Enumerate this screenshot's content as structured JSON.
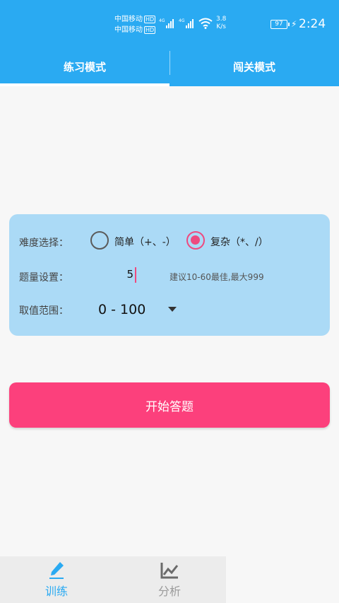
{
  "status_bar": {
    "carrier_1": "中国移动",
    "carrier_2": "中国移动",
    "hd_badge": "HD",
    "network_1": "4G",
    "network_2": "4G",
    "speed_value": "3.8",
    "speed_unit": "K/s",
    "battery": "97",
    "time": "2:24"
  },
  "tabs": [
    {
      "label": "练习模式",
      "active": true
    },
    {
      "label": "闯关模式",
      "active": false
    }
  ],
  "settings": {
    "difficulty_label": "难度选择：",
    "simple_option": "简单（+、-）",
    "complex_option": "复杂（*、/）",
    "selected_difficulty": "complex",
    "count_label": "题量设置：",
    "count_value": "5",
    "count_hint": "建议10-60最佳,最大999",
    "range_label": "取值范围：",
    "range_value": "0 - 100"
  },
  "start_button": "开始答题",
  "bottom_nav": [
    {
      "label": "训练",
      "icon": "pencil-icon",
      "active": true
    },
    {
      "label": "分析",
      "icon": "line-chart-icon",
      "active": false
    }
  ],
  "colors": {
    "primary": "#2aaaf2",
    "accent": "#fc407c",
    "card": "#abdaf6"
  }
}
